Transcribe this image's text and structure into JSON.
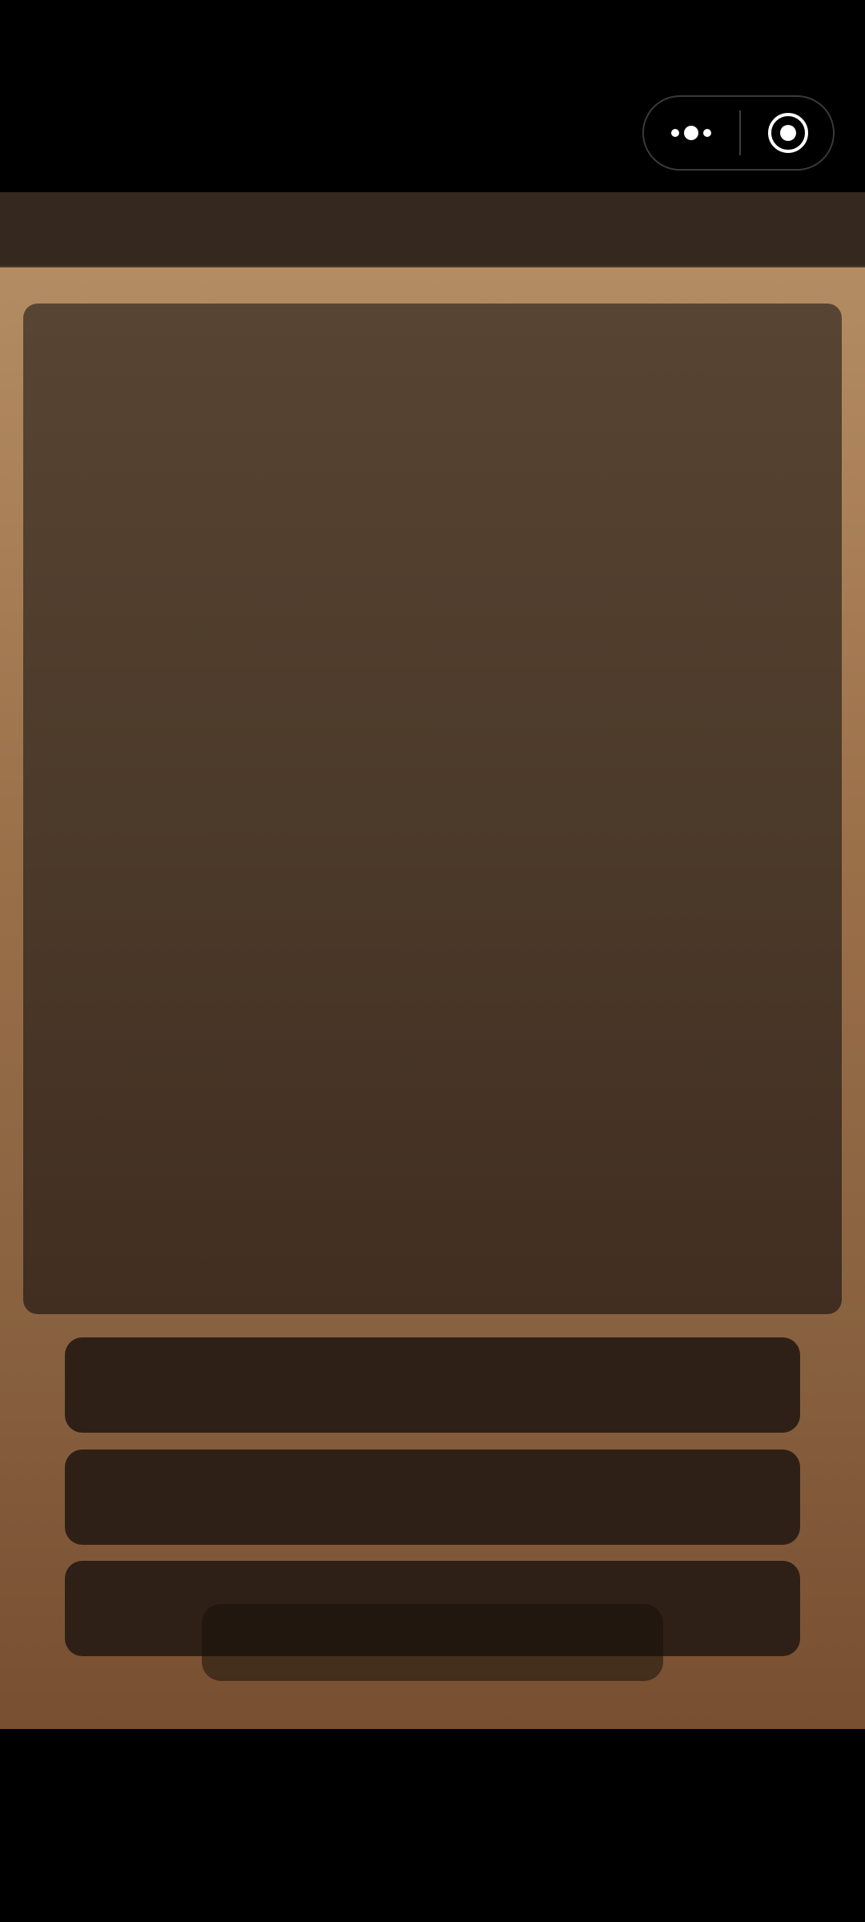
{
  "colors": {
    "status_background": "#000000",
    "navbar_background": "#35291f",
    "content_gradient_top": "#b48c63",
    "content_gradient_bottom": "#784f31",
    "card_background": "#584432",
    "option_background": "#2e2016",
    "capsule_border": "#3a3a3a",
    "icon_color": "#ffffff"
  },
  "navbar": {
    "title": ""
  },
  "capsule": {
    "more_icon": "more-dots-icon",
    "close_icon": "target-close-icon"
  },
  "main_card": {
    "text": ""
  },
  "options": [
    {
      "label": ""
    },
    {
      "label": ""
    },
    {
      "label": ""
    }
  ]
}
